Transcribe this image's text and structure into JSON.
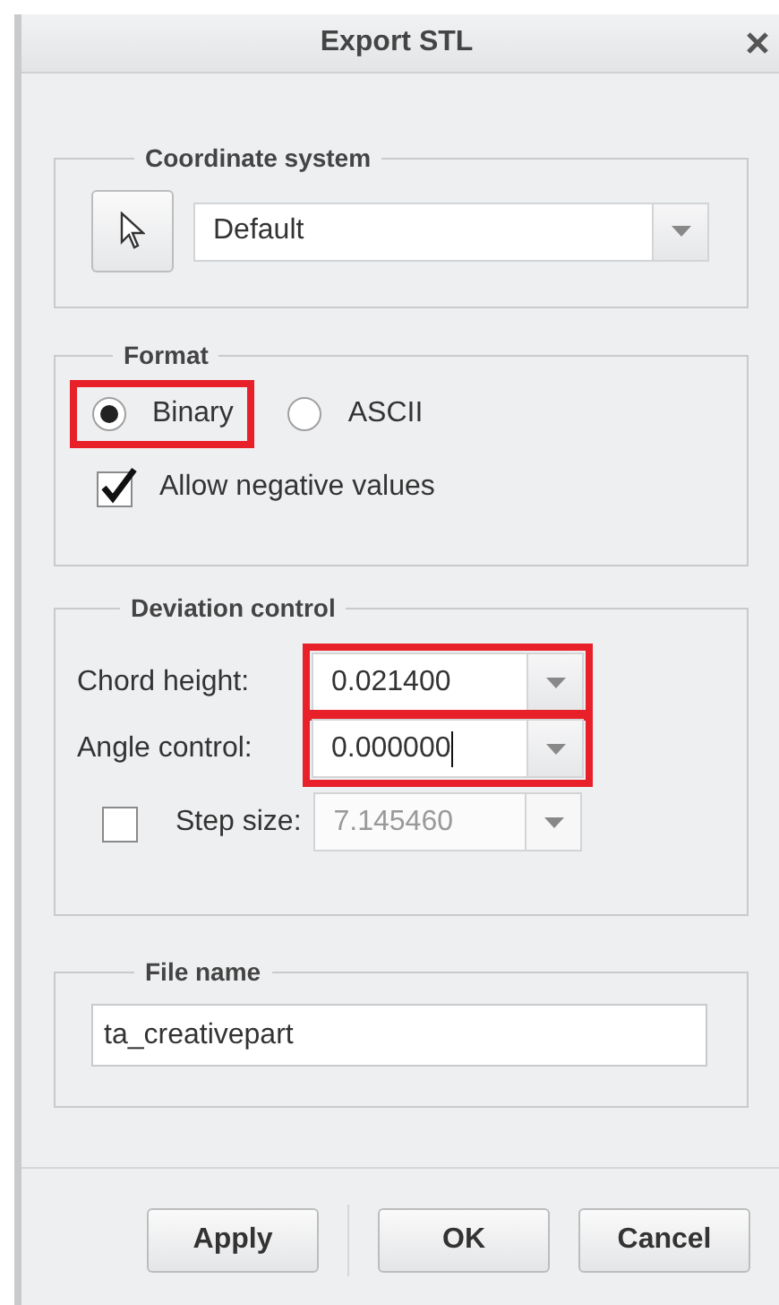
{
  "window": {
    "title": "Export STL"
  },
  "coordinate_system": {
    "legend": "Coordinate system",
    "value": "Default"
  },
  "format": {
    "legend": "Format",
    "options": [
      {
        "label": "Binary",
        "selected": true,
        "highlighted": true
      },
      {
        "label": "ASCII",
        "selected": false,
        "highlighted": false
      }
    ],
    "allow_negative": {
      "label": "Allow negative values",
      "checked": true
    }
  },
  "deviation": {
    "legend": "Deviation control",
    "fields": [
      {
        "label": "Chord height:",
        "value": "0.021400",
        "highlighted": true,
        "focused": false
      },
      {
        "label": "Angle control:",
        "value": "0.000000",
        "highlighted": true,
        "focused": true
      }
    ],
    "step_size": {
      "label": "Step size:",
      "value": "7.145460",
      "checked": false,
      "disabled": true
    }
  },
  "file_name": {
    "legend": "File name",
    "value": "ta_creativepart"
  },
  "buttons": [
    {
      "label": "Apply",
      "separator_after": true
    },
    {
      "label": "OK",
      "separator_after": false
    },
    {
      "label": "Cancel",
      "separator_after": false
    }
  ]
}
